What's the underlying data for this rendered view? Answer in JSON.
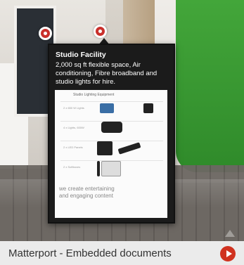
{
  "popup": {
    "title": "Studio Facility",
    "description": "2,000 sq ft flexible space, Air conditioning, Fibre broadband and studio lights for hire.",
    "document": {
      "heading": "Studio Lighting Equipment",
      "rows": [
        {
          "label": "2 x 650 W Lights"
        },
        {
          "label": "4 x Lights, 600W"
        },
        {
          "label": "2 x LED Panels"
        },
        {
          "label": "2 x Softboxes"
        }
      ],
      "footer": "we create entertaining and engaging content"
    }
  },
  "caption": {
    "title": "Matterport - Embedded documents",
    "play_icon": "play-icon"
  }
}
